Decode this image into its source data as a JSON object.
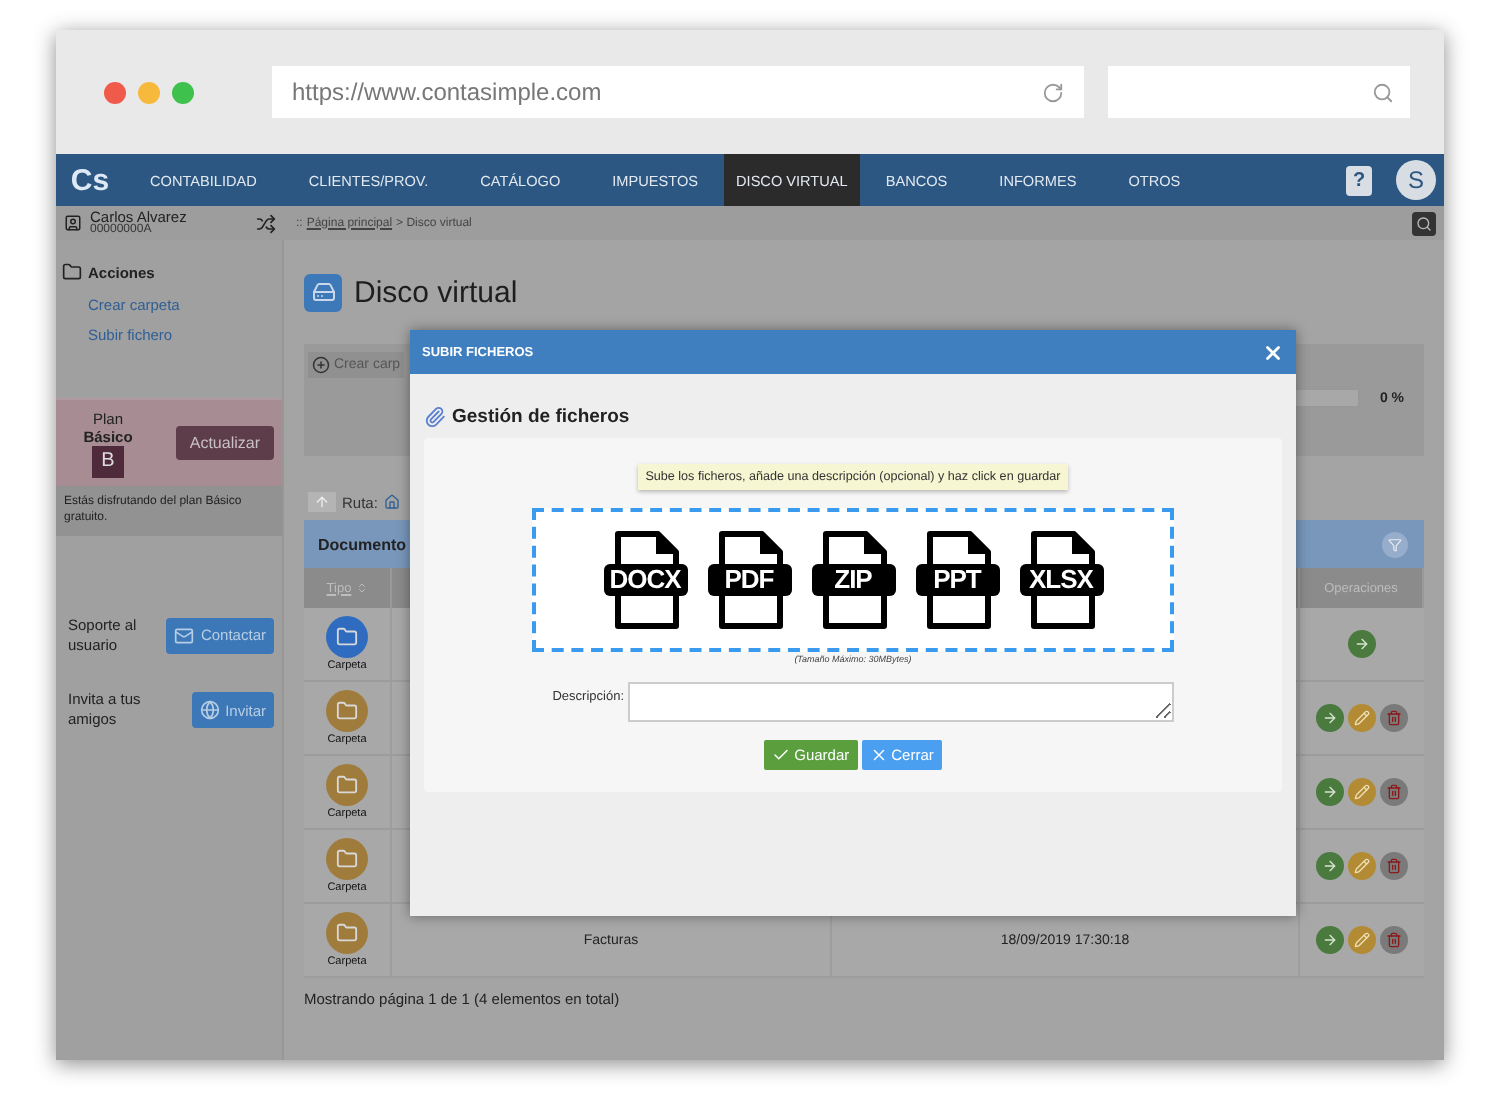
{
  "browser": {
    "url": "https://www.contasimple.com"
  },
  "nav": {
    "logo": "Cs",
    "items": [
      {
        "label": "CONTABILIDAD",
        "selected": false
      },
      {
        "label": "CLIENTES/PROV.",
        "selected": false
      },
      {
        "label": "CATÁLOGO",
        "selected": false
      },
      {
        "label": "IMPUESTOS",
        "selected": false
      },
      {
        "label": "DISCO VIRTUAL",
        "selected": true
      },
      {
        "label": "BANCOS",
        "selected": false
      },
      {
        "label": "INFORMES",
        "selected": false
      },
      {
        "label": "OTROS",
        "selected": false
      }
    ],
    "help": "?",
    "avatar": "S"
  },
  "user": {
    "name": "Carlos Alvarez",
    "id": "00000000A"
  },
  "breadcrumb": {
    "prefix": "::",
    "link": "Página principal",
    "current": "> Disco virtual"
  },
  "sidebar": {
    "actions_title": "Acciones",
    "links": [
      "Crear carpeta",
      "Subir fichero"
    ],
    "plan": {
      "label": "Plan",
      "name": "Básico",
      "badge": "B",
      "button": "Actualizar",
      "note": "Estás disfrutando del plan Básico gratuito."
    },
    "support": {
      "text": "Soporte al usuario",
      "button": "Contactar"
    },
    "invite": {
      "text": "Invita a tus amigos",
      "button": "Invitar"
    }
  },
  "main": {
    "title": "Disco virtual",
    "create_button": "Crear carp",
    "progress": {
      "level": 0,
      "reading": "0 %"
    },
    "path_label": "Ruta:",
    "table": {
      "title": "Documento",
      "columns": [
        "Tipo",
        "Operaciones"
      ],
      "rows": [
        {
          "type_label": "Carpeta",
          "color": "#2f6cc0",
          "operations": [
            {
              "kind": "open"
            }
          ]
        },
        {
          "type_label": "Carpeta",
          "color": "#a07c3c",
          "operations": [
            {
              "kind": "open"
            },
            {
              "kind": "edit"
            },
            {
              "kind": "delete"
            }
          ]
        },
        {
          "type_label": "Carpeta",
          "color": "#a07c3c",
          "operations": [
            {
              "kind": "open"
            },
            {
              "kind": "edit"
            },
            {
              "kind": "delete"
            }
          ]
        },
        {
          "type_label": "Carpeta",
          "color": "#a07c3c",
          "operations": [
            {
              "kind": "open"
            },
            {
              "kind": "edit"
            },
            {
              "kind": "delete"
            }
          ]
        },
        {
          "type_label": "Carpeta",
          "color": "#a07c3c",
          "name": "Facturas",
          "date": "18/09/2019 17:30:18",
          "operations": [
            {
              "kind": "open"
            },
            {
              "kind": "edit"
            },
            {
              "kind": "delete"
            }
          ]
        }
      ]
    },
    "footer": "Mostrando página 1 de 1 (4 elementos en total)"
  },
  "modal": {
    "title": "SUBIR FICHEROS",
    "heading": "Gestión de ficheros",
    "hint": "Sube los ficheros, añade una descripción (opcional) y haz click en guardar",
    "file_types": [
      "DOCX",
      "PDF",
      "ZIP",
      "PPT",
      "XLSX"
    ],
    "max_size": "(Tamaño Máximo: 30MBytes)",
    "description_label": "Descripción:",
    "buttons": [
      {
        "label": "Guardar",
        "kind": "save"
      },
      {
        "label": "Cerrar",
        "kind": "cancel"
      }
    ]
  }
}
